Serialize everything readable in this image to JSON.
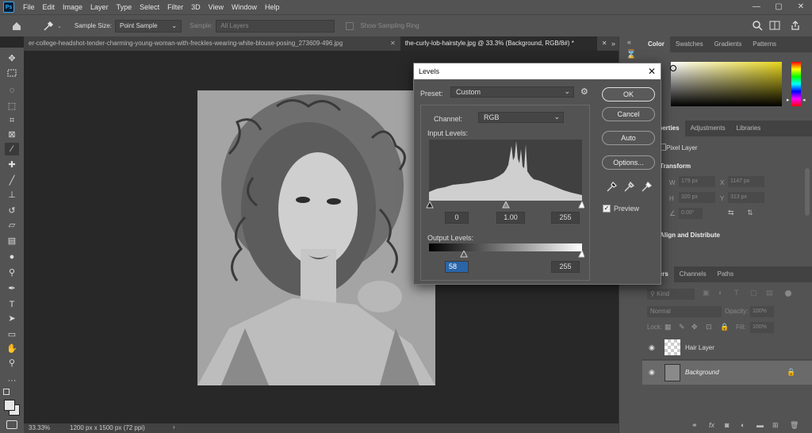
{
  "menubar": {
    "app_badge": "Ps",
    "items": [
      "File",
      "Edit",
      "Image",
      "Layer",
      "Type",
      "Select",
      "Filter",
      "3D",
      "View",
      "Window",
      "Help"
    ],
    "minimize": "—",
    "maximize": "▢",
    "close": "✕"
  },
  "options_bar": {
    "sample_size_label": "Sample Size:",
    "sample_size_value": "Point Sample",
    "sample_label": "Sample:",
    "sample_value": "All Layers",
    "show_ring_label": "Show Sampling Ring"
  },
  "tabs": [
    {
      "label": "er-college-headshot-tender-charming-young-woman-with-freckles-wearing-white-blouse-posing_273609-496.jpg",
      "close": "✕"
    },
    {
      "label": "the-curly-lob-hairstyle.jpg @ 33.3% (Background, RGB/8#) *",
      "close": "✕"
    }
  ],
  "status": {
    "zoom": "33.33%",
    "doc_info": "1200 px x 1500 px (72 ppi)"
  },
  "levels": {
    "title": "Levels",
    "preset_label": "Preset:",
    "preset_value": "Custom",
    "channel_label": "Channel:",
    "channel_value": "RGB",
    "input_levels_label": "Input Levels:",
    "input_black": "0",
    "input_gamma": "1.00",
    "input_white": "255",
    "output_levels_label": "Output Levels:",
    "output_black": "58",
    "output_white": "255",
    "ok": "OK",
    "cancel": "Cancel",
    "auto": "Auto",
    "options": "Options...",
    "preview_label": "Preview",
    "preview_checked": true
  },
  "color_panel": {
    "tabs": [
      "Color",
      "Swatches",
      "Gradients",
      "Patterns"
    ]
  },
  "properties_panel": {
    "tabs": [
      "Properties",
      "Adjustments",
      "Libraries"
    ],
    "layer_type": "Pixel Layer",
    "transform_label": "Transform",
    "w_label": "W",
    "w_value": "179 px",
    "x_label": "X",
    "x_value": "1147 px",
    "h_label": "H",
    "h_value": "320 px",
    "y_label": "Y",
    "y_value": "313 px",
    "angle_value": "0.00°",
    "align_label": "Align and Distribute"
  },
  "layers_panel": {
    "tabs": [
      "Layers",
      "Channels",
      "Paths"
    ],
    "kind_placeholder": "Kind",
    "blend_mode": "Normal",
    "opacity_label": "Opacity:",
    "opacity_value": "100%",
    "lock_label": "Lock:",
    "fill_label": "Fill:",
    "fill_value": "100%",
    "layers": [
      {
        "name": "Hair Layer",
        "visible": true,
        "locked": false,
        "selected": false
      },
      {
        "name": "Background",
        "visible": true,
        "locked": true,
        "selected": true
      }
    ]
  },
  "colors": {
    "accent": "#31a8ff",
    "app_bg": "#535353",
    "canvas_bg": "#282828",
    "dialog_title_bg": "#ffffff",
    "picker_hue": "#e8d61c"
  }
}
